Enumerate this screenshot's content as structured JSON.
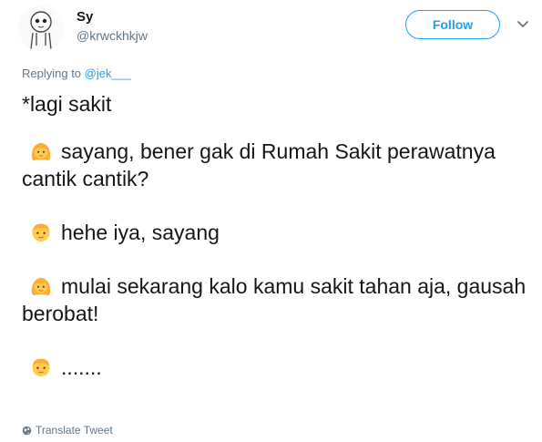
{
  "user": {
    "display_name": "Sy",
    "handle": "@krwckhkjw"
  },
  "follow": {
    "label": "Follow"
  },
  "reply": {
    "prefix": "Replying to ",
    "mention": "@jek___"
  },
  "tweet": {
    "lines": [
      {
        "emoji": "",
        "text": "*lagi sakit"
      },
      {
        "emoji": "girl-face-icon",
        "text": "sayang, bener gak di Rumah Sakit perawatnya cantik cantik?"
      },
      {
        "emoji": "boy-face-icon",
        "text": "hehe iya,  sayang"
      },
      {
        "emoji": "girl-face-icon",
        "text": "mulai sekarang kalo kamu sakit tahan aja, gausah berobat!"
      },
      {
        "emoji": "boy-face-icon",
        "text": "......."
      }
    ]
  },
  "translate": {
    "label": "Translate Tweet"
  },
  "colors": {
    "accent": "#1da1f2",
    "secondary_text": "#657786",
    "primary_text": "#14171a"
  }
}
